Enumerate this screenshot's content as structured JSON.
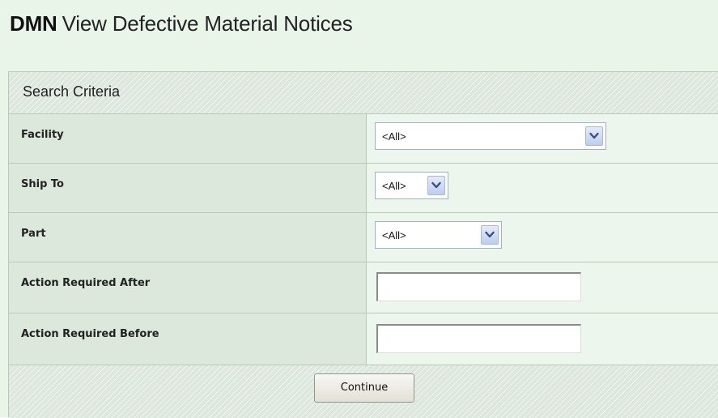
{
  "page": {
    "title_code": "DMN",
    "title_name": "View Defective Material Notices"
  },
  "panel": {
    "header": "Search Criteria"
  },
  "fields": [
    {
      "label": "Facility",
      "type": "select",
      "value": "<All>"
    },
    {
      "label": "Ship To",
      "type": "select",
      "value": "<All>"
    },
    {
      "label": "Part",
      "type": "select",
      "value": "<All>"
    },
    {
      "label": "Action Required After",
      "type": "text",
      "value": ""
    },
    {
      "label": "Action Required Before",
      "type": "text",
      "value": ""
    }
  ],
  "footer": {
    "continue_label": "Continue"
  },
  "icons": {
    "dropdown": "chevron-down-icon"
  },
  "colors": {
    "background": "#eaf5ea",
    "label_cell": "#dbe8db",
    "value_cell": "#edf6ed",
    "border": "#b9c9b9"
  }
}
